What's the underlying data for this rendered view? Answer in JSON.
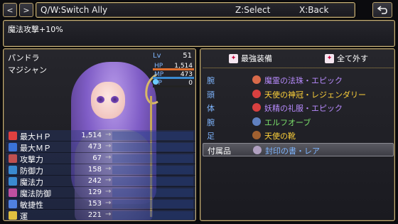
{
  "nav": {
    "prev_label": "<",
    "next_label": ">"
  },
  "topbar": {
    "switch_hint": "Q/W:Switch Ally",
    "select_hint": "Z:Select",
    "back_hint": "X:Back"
  },
  "description": "魔法攻撃+10%",
  "character": {
    "name": "パンドラ",
    "class": "マジシャン",
    "level_label": "Lv",
    "level": "51",
    "hp_label": "HP",
    "hp": "1,514",
    "hp_fill": 1.0,
    "mp_label": "MP",
    "mp": "473",
    "mp_fill": 1.0,
    "tp_label": "TP",
    "tp": "0",
    "tp_fill": 0
  },
  "stats": [
    {
      "label": "最大ＨＰ",
      "value": "1,514",
      "arrow": "→",
      "icon": "heart-icon",
      "color": "#e04040"
    },
    {
      "label": "最大ＭＰ",
      "value": "473",
      "arrow": "→",
      "icon": "mp-icon",
      "color": "#3a72d8"
    },
    {
      "label": "攻撃力",
      "value": "67",
      "arrow": "→",
      "icon": "sword-icon",
      "color": "#c05050"
    },
    {
      "label": "防御力",
      "value": "158",
      "arrow": "→",
      "icon": "shield-icon",
      "color": "#3a8ad0"
    },
    {
      "label": "魔法力",
      "value": "242",
      "arrow": "→",
      "icon": "magic-icon",
      "color": "#3a8ad0"
    },
    {
      "label": "魔法防御",
      "value": "129",
      "arrow": "→",
      "icon": "magic-defense-icon",
      "color": "#c050a0"
    },
    {
      "label": "敏捷性",
      "value": "153",
      "arrow": "→",
      "icon": "boot-icon",
      "color": "#5080e0"
    },
    {
      "label": "運",
      "value": "221",
      "arrow": "→",
      "icon": "luck-icon",
      "color": "#e0c040"
    }
  ],
  "actions": {
    "optimize_label": "最強装備",
    "clear_label": "全て外す"
  },
  "equipment": [
    {
      "slot": "腕",
      "item": "魔霊の法珠・エピック",
      "color": "#b98cff",
      "icon_color": "#d86a4a"
    },
    {
      "slot": "頭",
      "item": "天使の神冠・レジェンダリー",
      "color": "#ffd23a",
      "icon_color": "#d84040"
    },
    {
      "slot": "体",
      "item": "妖精の礼服・エピック",
      "color": "#b98cff",
      "icon_color": "#d84040"
    },
    {
      "slot": "腕",
      "item": "エルフオーブ",
      "color": "#7be06b",
      "icon_color": "#6080c0"
    },
    {
      "slot": "足",
      "item": "天使の靴",
      "color": "#ffd23a",
      "icon_color": "#a06030"
    },
    {
      "slot": "付属品",
      "item": "封印の書・レア",
      "color": "#7fb6ff",
      "icon_color": "#b0a0c0"
    }
  ],
  "colors": {
    "border": "#c8b27a",
    "label_blue": "#7fb6ff",
    "hp_bar": "#e07030",
    "mp_bar": "#3a8ad0",
    "tp_bar": "#40c060"
  }
}
